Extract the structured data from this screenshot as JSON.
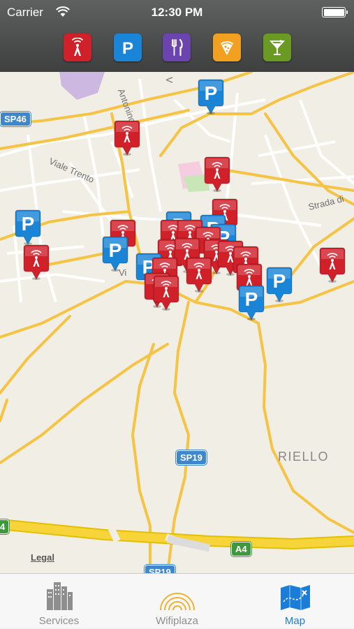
{
  "status_bar": {
    "carrier": "Carrier",
    "time": "12:30 PM"
  },
  "filters": [
    {
      "name": "wifi",
      "icon": "wifi-tower-icon",
      "color": "#d0202a"
    },
    {
      "name": "parking",
      "icon": "parking-icon",
      "color": "#1a84d6"
    },
    {
      "name": "restaurant",
      "icon": "fork-knife-icon",
      "color": "#6c44b0"
    },
    {
      "name": "pizza",
      "icon": "pizza-slice-icon",
      "color": "#f2a020"
    },
    {
      "name": "bar",
      "icon": "cocktail-glass-icon",
      "color": "#6a9a22"
    }
  ],
  "map": {
    "labels": {
      "viale_trento": "Viale Trento",
      "strada": "Strada di",
      "antonino": "Antonino",
      "riello": "RIELLO",
      "vi": "Vi",
      "v": "V"
    },
    "shields": {
      "sp46": "SP46",
      "sp19a": "SP19",
      "sp19b": "SP19",
      "a4": "A4",
      "left": "4"
    },
    "legal": "Legal",
    "colors": {
      "wifi_pin": "#d0202a",
      "parking_pin": "#1a84d6",
      "road_major": "#f6c445",
      "highway": "#f2c200"
    }
  },
  "tabbar": {
    "tabs": [
      {
        "label": "Services",
        "icon": "buildings-icon",
        "active": false
      },
      {
        "label": "Wifiplaza",
        "icon": "wifi-rings-icon",
        "active": false
      },
      {
        "label": "Map",
        "icon": "map-icon",
        "active": true
      }
    ],
    "active_color": "#1a7dd8"
  }
}
